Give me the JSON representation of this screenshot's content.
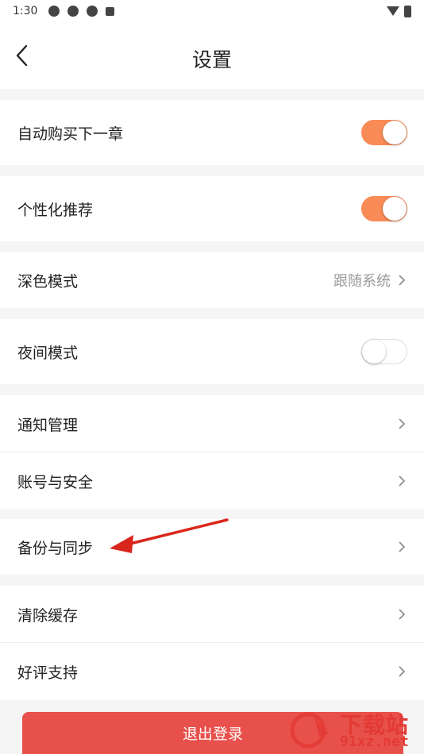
{
  "status_bar": {
    "time": "1:30"
  },
  "header": {
    "title": "设置"
  },
  "settings": {
    "auto_buy": {
      "label": "自动购买下一章",
      "enabled": true
    },
    "personalized": {
      "label": "个性化推荐",
      "enabled": true
    },
    "dark_mode": {
      "label": "深色模式",
      "value": "跟随系统"
    },
    "night_mode": {
      "label": "夜间模式",
      "enabled": false
    },
    "notifications": {
      "label": "通知管理"
    },
    "account_security": {
      "label": "账号与安全"
    },
    "backup_sync": {
      "label": "备份与同步"
    },
    "clear_cache": {
      "label": "清除缓存"
    },
    "rate_support": {
      "label": "好评支持"
    }
  },
  "logout": {
    "label": "退出登录"
  },
  "watermark": {
    "text_main": "下载站",
    "text_domain": "91xz.net"
  },
  "colors": {
    "toggle_on": "#f98b56",
    "logout": "#e8504b",
    "annotation_arrow": "#d9261c"
  }
}
